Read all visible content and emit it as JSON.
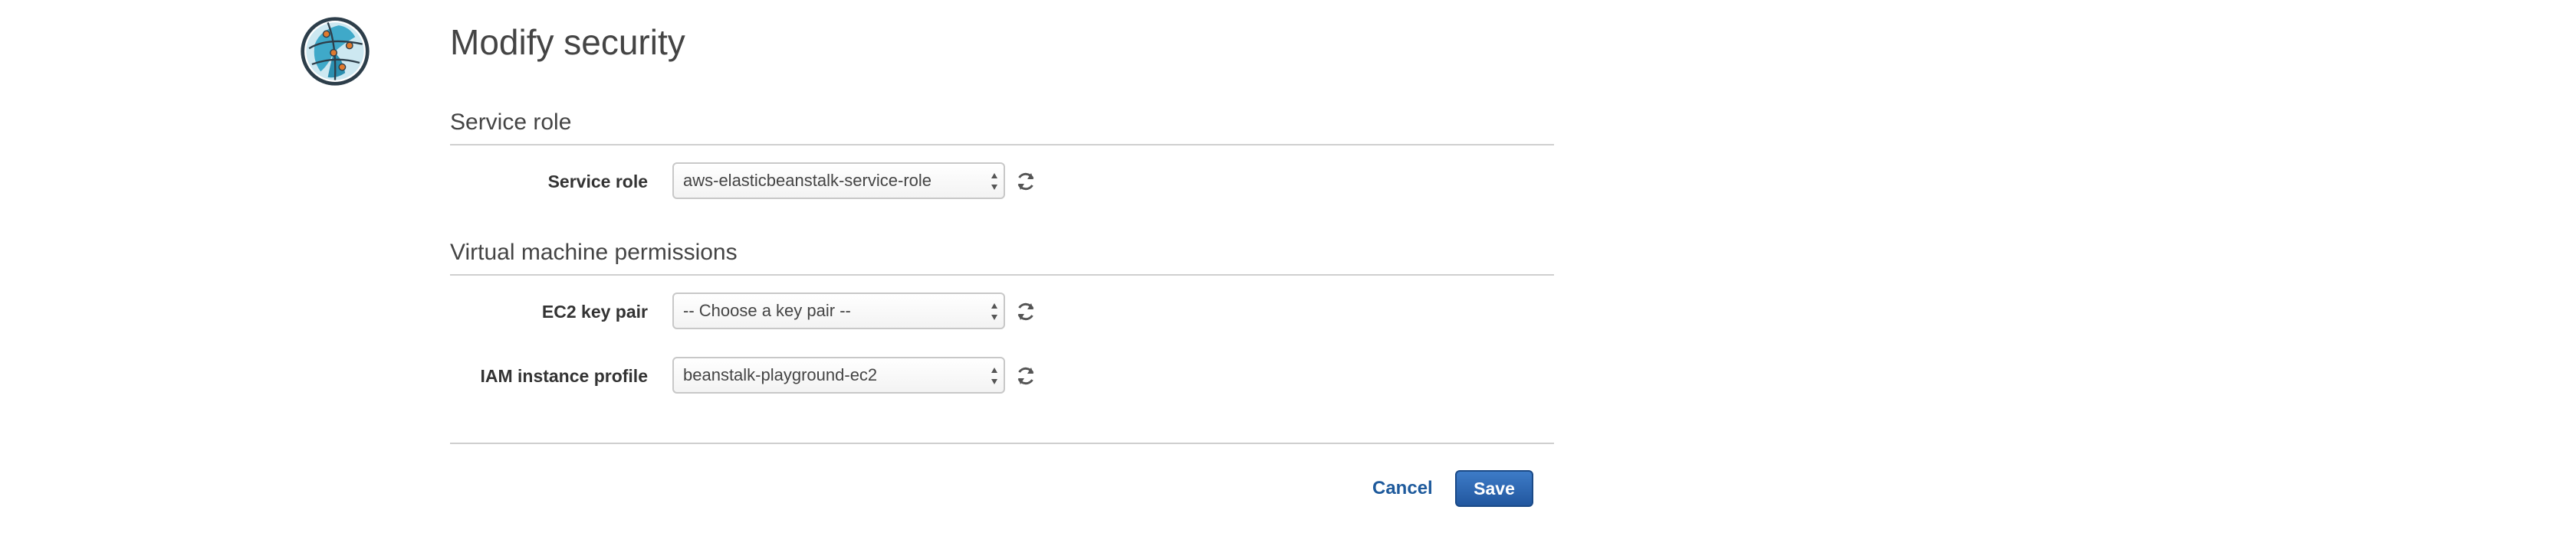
{
  "header": {
    "title": "Modify security",
    "logo_icon": "globe-logo-icon"
  },
  "sections": [
    {
      "title": "Service role",
      "fields": [
        {
          "label": "Service role",
          "value": "aws-elasticbeanstalk-service-role",
          "refresh_icon": "refresh-icon"
        }
      ]
    },
    {
      "title": "Virtual machine permissions",
      "fields": [
        {
          "label": "EC2 key pair",
          "value": "-- Choose a key pair --",
          "refresh_icon": "refresh-icon"
        },
        {
          "label": "IAM instance profile",
          "value": "beanstalk-playground-ec2",
          "refresh_icon": "refresh-icon"
        }
      ]
    }
  ],
  "footer": {
    "cancel_label": "Cancel",
    "save_label": "Save"
  },
  "colors": {
    "primary_button": "#2b64ad",
    "link": "#1e5a9c",
    "logo_teal": "#3fa9c9",
    "logo_dark": "#2d3e4a"
  }
}
